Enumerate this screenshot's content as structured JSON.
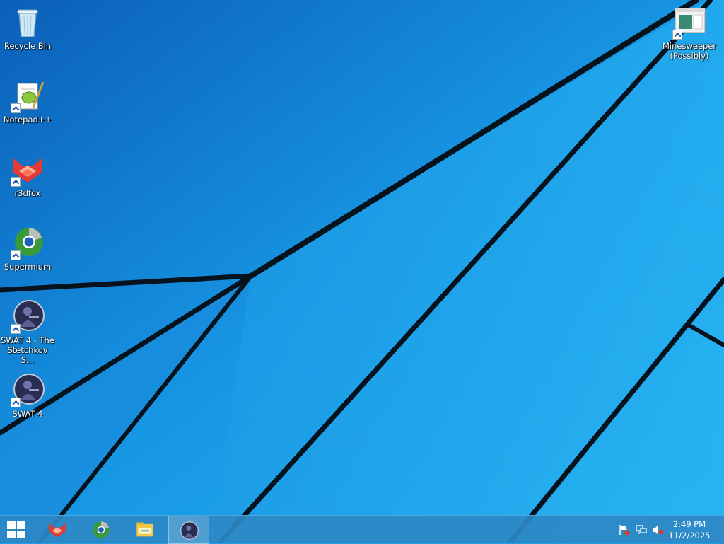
{
  "desktop": {
    "icons": [
      {
        "label": "Recycle Bin",
        "icon": "recycle-bin-icon"
      },
      {
        "label": "Notepad++",
        "icon": "notepadpp-icon"
      },
      {
        "label": "r3dfox",
        "icon": "r3dfox-icon"
      },
      {
        "label": "Supermium",
        "icon": "supermium-icon"
      },
      {
        "label": "SWAT 4 - The\nStetchkov S...",
        "icon": "swat4-icon"
      },
      {
        "label": "SWAT 4",
        "icon": "swat4-icon"
      },
      {
        "label": "Minesweeper\n(Possibly)",
        "icon": "minesweeper-icon"
      }
    ]
  },
  "taskbar": {
    "start_icon": "windows-logo-icon",
    "pinned": [
      {
        "icon": "r3dfox-icon"
      },
      {
        "icon": "supermium-icon"
      },
      {
        "icon": "file-explorer-icon"
      },
      {
        "icon": "swat4-icon",
        "active": true
      }
    ],
    "tray": [
      {
        "icon": "action-center-flag-icon"
      },
      {
        "icon": "network-icon"
      },
      {
        "icon": "volume-muted-icon"
      }
    ],
    "clock": {
      "time": "2:49 PM",
      "date": "11/2/2025"
    }
  },
  "colors": {
    "wallpaper_light": "#1aa7f0",
    "wallpaper_dark": "#0d63b8",
    "taskbar": "#2c88c4"
  }
}
